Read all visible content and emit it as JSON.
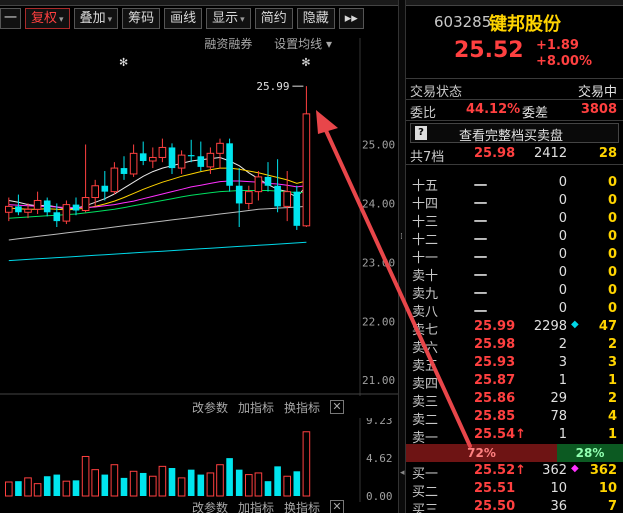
{
  "toolbar": {
    "buttons": [
      {
        "label": "一",
        "active": false
      },
      {
        "label": "复权",
        "active": true,
        "dropdown": true
      },
      {
        "label": "叠加",
        "active": false,
        "dropdown": true
      },
      {
        "label": "筹码",
        "active": false
      },
      {
        "label": "画线",
        "active": false
      },
      {
        "label": "显示",
        "active": false,
        "dropdown": true
      },
      {
        "label": "简约",
        "active": false
      },
      {
        "label": "隐藏",
        "active": false
      },
      {
        "label": "▸▸",
        "active": false
      }
    ]
  },
  "subbar": {
    "margin_label": "融资融券",
    "ma_label": "设置均线 ▾"
  },
  "kchart": {
    "high_label": "25.99",
    "star_marks": [
      "✻",
      "✻"
    ],
    "price_axis": [
      "25.00",
      "24.00",
      "23.00",
      "22.00",
      "21.00"
    ],
    "candles": [
      {
        "o": 23.85,
        "h": 24.1,
        "l": 23.7,
        "c": 23.95
      },
      {
        "o": 23.95,
        "h": 24.15,
        "l": 23.8,
        "c": 23.85
      },
      {
        "o": 23.85,
        "h": 24.0,
        "l": 23.75,
        "c": 23.9
      },
      {
        "o": 23.9,
        "h": 24.2,
        "l": 23.82,
        "c": 24.05
      },
      {
        "o": 24.05,
        "h": 24.1,
        "l": 23.78,
        "c": 23.85
      },
      {
        "o": 23.85,
        "h": 24.0,
        "l": 23.6,
        "c": 23.7
      },
      {
        "o": 23.7,
        "h": 24.05,
        "l": 23.65,
        "c": 23.98
      },
      {
        "o": 23.98,
        "h": 24.1,
        "l": 23.8,
        "c": 23.88
      },
      {
        "o": 23.88,
        "h": 25.0,
        "l": 23.85,
        "c": 24.1
      },
      {
        "o": 24.1,
        "h": 24.4,
        "l": 23.95,
        "c": 24.3
      },
      {
        "o": 24.3,
        "h": 24.55,
        "l": 24.05,
        "c": 24.2
      },
      {
        "o": 24.2,
        "h": 24.7,
        "l": 24.15,
        "c": 24.6
      },
      {
        "o": 24.6,
        "h": 24.8,
        "l": 24.4,
        "c": 24.5
      },
      {
        "o": 24.5,
        "h": 25.0,
        "l": 24.45,
        "c": 24.85
      },
      {
        "o": 24.85,
        "h": 25.05,
        "l": 24.65,
        "c": 24.72
      },
      {
        "o": 24.72,
        "h": 24.95,
        "l": 24.6,
        "c": 24.78
      },
      {
        "o": 24.78,
        "h": 25.1,
        "l": 24.7,
        "c": 24.95
      },
      {
        "o": 24.95,
        "h": 25.02,
        "l": 24.5,
        "c": 24.6
      },
      {
        "o": 24.6,
        "h": 24.9,
        "l": 24.5,
        "c": 24.82
      },
      {
        "o": 24.82,
        "h": 25.08,
        "l": 24.7,
        "c": 24.8
      },
      {
        "o": 24.8,
        "h": 25.05,
        "l": 24.55,
        "c": 24.62
      },
      {
        "o": 24.62,
        "h": 24.95,
        "l": 24.5,
        "c": 24.85
      },
      {
        "o": 24.85,
        "h": 25.1,
        "l": 24.6,
        "c": 25.02
      },
      {
        "o": 25.02,
        "h": 25.1,
        "l": 24.2,
        "c": 24.3
      },
      {
        "o": 24.3,
        "h": 24.6,
        "l": 23.6,
        "c": 24.0
      },
      {
        "o": 24.0,
        "h": 24.3,
        "l": 23.9,
        "c": 24.2
      },
      {
        "o": 24.2,
        "h": 24.55,
        "l": 24.05,
        "c": 24.45
      },
      {
        "o": 24.45,
        "h": 24.7,
        "l": 24.2,
        "c": 24.3
      },
      {
        "o": 24.3,
        "h": 24.75,
        "l": 23.85,
        "c": 23.95
      },
      {
        "o": 23.95,
        "h": 24.55,
        "l": 23.7,
        "c": 24.2
      },
      {
        "o": 24.2,
        "h": 24.3,
        "l": 23.55,
        "c": 23.62
      },
      {
        "o": 23.62,
        "h": 25.99,
        "l": 23.6,
        "c": 25.52
      }
    ],
    "ma_lines": [
      {
        "color": "#e8e8e8",
        "values": [
          24.05,
          24.02,
          23.98,
          23.96,
          23.97,
          23.94,
          23.9,
          23.92,
          23.96,
          24.02,
          24.08,
          24.16,
          24.26,
          24.36,
          24.46,
          24.54,
          24.6,
          24.64,
          24.68,
          24.72,
          24.74,
          24.76,
          24.78,
          24.72,
          24.64,
          24.52,
          24.42,
          24.32,
          24.24,
          24.2,
          24.1,
          24.3
        ]
      },
      {
        "color": "#ffd400",
        "values": [
          23.92,
          23.91,
          23.9,
          23.9,
          23.91,
          23.9,
          23.89,
          23.9,
          23.92,
          23.95,
          23.99,
          24.04,
          24.1,
          24.17,
          24.24,
          24.3,
          24.36,
          24.41,
          24.46,
          24.5,
          24.54,
          24.57,
          24.6,
          24.6,
          24.58,
          24.55,
          24.52,
          24.48,
          24.44,
          24.4,
          24.34,
          24.38
        ]
      },
      {
        "color": "#ff30ff",
        "values": [
          23.98,
          23.97,
          23.96,
          23.95,
          23.95,
          23.94,
          23.93,
          23.93,
          23.93,
          23.94,
          23.96,
          23.98,
          24.01,
          24.04,
          24.08,
          24.12,
          24.16,
          24.2,
          24.24,
          24.28,
          24.31,
          24.34,
          24.37,
          24.38,
          24.38,
          24.37,
          24.36,
          24.34,
          24.33,
          24.31,
          24.28,
          24.3
        ]
      },
      {
        "color": "#00e060",
        "values": [
          23.75,
          23.76,
          23.77,
          23.78,
          23.79,
          23.8,
          23.81,
          23.82,
          23.84,
          23.86,
          23.88,
          23.9,
          23.93,
          23.96,
          23.99,
          24.02,
          24.05,
          24.08,
          24.11,
          24.14,
          24.16,
          24.18,
          24.2,
          24.21,
          24.22,
          24.22,
          24.22,
          24.22,
          24.21,
          24.2,
          24.18,
          24.19
        ]
      },
      {
        "color": "#bbbbbb",
        "values": [
          23.38,
          23.4,
          23.42,
          23.44,
          23.46,
          23.48,
          23.5,
          23.52,
          23.54,
          23.56,
          23.58,
          23.6,
          23.62,
          23.64,
          23.66,
          23.68,
          23.7,
          23.72,
          23.74,
          23.76,
          23.78,
          23.8,
          23.82,
          23.84,
          23.86,
          23.88,
          23.9,
          23.91,
          23.92,
          23.93,
          23.94,
          23.95
        ]
      },
      {
        "color": "#00d8e8",
        "values": [
          23.03,
          23.04,
          23.05,
          23.06,
          23.07,
          23.08,
          23.09,
          23.1,
          23.11,
          23.12,
          23.13,
          23.14,
          23.15,
          23.16,
          23.17,
          23.18,
          23.19,
          23.2,
          23.21,
          23.22,
          23.23,
          23.24,
          23.25,
          23.26,
          23.27,
          23.28,
          23.29,
          23.3,
          23.31,
          23.32,
          23.33,
          23.34
        ]
      }
    ],
    "price_min": 20.8,
    "price_max": 26.4
  },
  "volpanel": {
    "buttons": [
      "改参数",
      "加指标",
      "换指标"
    ],
    "close_label": "✕",
    "axis": [
      "9.23",
      "4.62",
      "0.00"
    ],
    "max": 9.23,
    "volumes": [
      1.7,
      1.8,
      2.2,
      1.5,
      2.4,
      2.6,
      1.8,
      1.9,
      4.8,
      3.2,
      2.6,
      3.8,
      2.2,
      3.0,
      2.8,
      2.4,
      3.6,
      3.4,
      2.2,
      3.2,
      2.6,
      2.8,
      3.8,
      4.6,
      3.2,
      2.6,
      2.8,
      1.8,
      3.6,
      2.4,
      3.0,
      7.8
    ]
  },
  "volpanel2": {
    "buttons": [
      "改参数",
      "加指标",
      "换指标"
    ],
    "close_label": "✕"
  },
  "quote": {
    "code": "603285",
    "name": "键邦股份",
    "price": "25.52",
    "change": "+1.89",
    "change_pct": "+8.00%",
    "status_label": "交易状态",
    "status_value": "交易中",
    "weibi_label": "委比",
    "weibi_value": "44.12%",
    "weicha_label": "委差",
    "weicha_value": "3808",
    "full_book_label": "查看完整档买卖盘",
    "full_book_icon": "?",
    "levels_label": "共7档",
    "levels_price": "25.98",
    "levels_vol": "2412",
    "levels_cnt": "28"
  },
  "asks": [
    {
      "lvl": "十五",
      "price": "一",
      "vol": "0",
      "mark": "",
      "cnt": "0"
    },
    {
      "lvl": "十四",
      "price": "一",
      "vol": "0",
      "mark": "",
      "cnt": "0"
    },
    {
      "lvl": "十三",
      "price": "一",
      "vol": "0",
      "mark": "",
      "cnt": "0"
    },
    {
      "lvl": "十二",
      "price": "一",
      "vol": "0",
      "mark": "",
      "cnt": "0"
    },
    {
      "lvl": "十一",
      "price": "一",
      "vol": "0",
      "mark": "",
      "cnt": "0"
    },
    {
      "lvl": "卖十",
      "price": "一",
      "vol": "0",
      "mark": "",
      "cnt": "0"
    },
    {
      "lvl": "卖九",
      "price": "一",
      "vol": "0",
      "mark": "",
      "cnt": "0"
    },
    {
      "lvl": "卖八",
      "price": "一",
      "vol": "0",
      "mark": "",
      "cnt": "0"
    },
    {
      "lvl": "卖七",
      "price": "25.99",
      "vol": "2298",
      "mark": "◆",
      "cnt": "47"
    },
    {
      "lvl": "卖六",
      "price": "25.98",
      "vol": "2",
      "mark": "",
      "cnt": "2"
    },
    {
      "lvl": "卖五",
      "price": "25.93",
      "vol": "3",
      "mark": "",
      "cnt": "3"
    },
    {
      "lvl": "卖四",
      "price": "25.87",
      "vol": "1",
      "mark": "",
      "cnt": "1"
    },
    {
      "lvl": "卖三",
      "price": "25.86",
      "vol": "29",
      "mark": "",
      "cnt": "2"
    },
    {
      "lvl": "卖二",
      "price": "25.85",
      "vol": "78",
      "mark": "",
      "cnt": "4"
    },
    {
      "lvl": "卖一",
      "price": "25.54↑",
      "vol": "1",
      "mark": "",
      "cnt": "1"
    }
  ],
  "ratio": {
    "up": "72%",
    "down": "28%",
    "up_fraction": 0.72
  },
  "bids": [
    {
      "lvl": "买一",
      "price": "25.52↑",
      "vol": "362",
      "mark": "◆",
      "cnt": "362"
    },
    {
      "lvl": "买二",
      "price": "25.51",
      "vol": "10",
      "mark": "",
      "cnt": "10"
    },
    {
      "lvl": "买三",
      "price": "25.50",
      "vol": "36",
      "mark": "",
      "cnt": "7"
    }
  ],
  "colors": {
    "up": "#ff4040",
    "down": "#00e5ee",
    "accent": "#ffd400",
    "arrow": "#e8464a"
  }
}
